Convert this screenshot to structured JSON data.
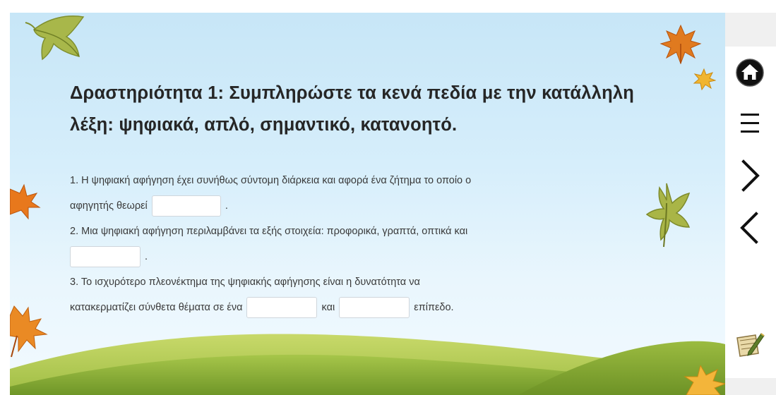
{
  "activity": {
    "title": "Δραστηριότητα 1: Συμπληρώστε τα κενά πεδία με την κατάλληλη λέξη: ψηφιακά, απλό, σημαντικό, κατανοητό.",
    "q1_part1": "1. Η ψηφιακή αφήγηση έχει συνήθως σύντομη διάρκεια και αφορά ένα ζήτημα το οποίο ο",
    "q1_part2": "αφηγητής θεωρεί",
    "q1_end": ".",
    "q2_part1": "2. Μια ψηφιακή αφήγηση περιλαμβάνει τα εξής στοιχεία: προφορικά, γραπτά, οπτικά και",
    "q2_end": ".",
    "q3_part1": "3. Το ισχυρότερο πλεονέκτημα της ψηφιακής αφήγησης είναι η δυνατότητα να",
    "q3_part2": "κατακερματίζει σύνθετα θέματα σε ένα",
    "q3_and": "και",
    "q3_end": "επίπεδο.",
    "blanks": [
      "",
      "",
      "",
      ""
    ]
  },
  "nav": {
    "icons": [
      "home-icon",
      "menu-icon",
      "next-icon",
      "previous-icon",
      "notes-icon"
    ]
  },
  "colors": {
    "sky_top": "#c7e6f7",
    "hill_front": "#8fb23c",
    "hill_back": "#b6cc5e",
    "nav_icon": "#111111"
  }
}
